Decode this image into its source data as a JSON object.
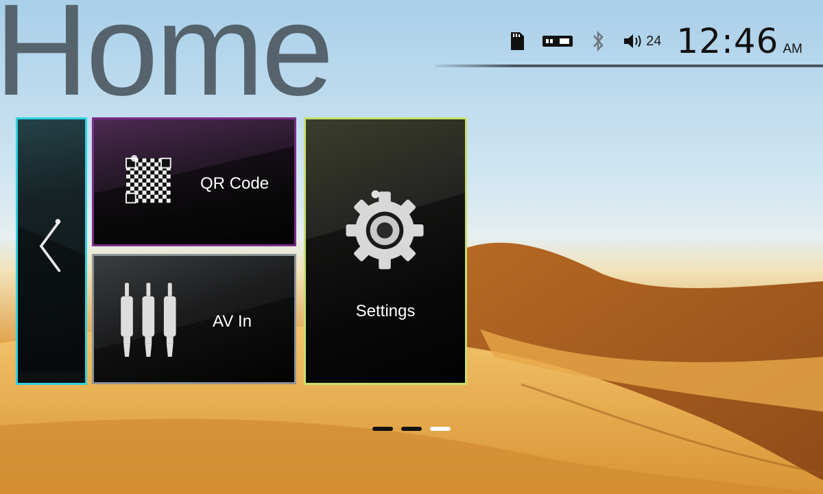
{
  "page": {
    "title": "Home"
  },
  "status_bar": {
    "icons": [
      "sd-card-icon",
      "usb-icon",
      "bluetooth-icon",
      "volume-icon"
    ],
    "volume": "24",
    "time": "12:46",
    "ampm": "AM"
  },
  "tiles": {
    "back": {
      "icon": "chevron-left-icon"
    },
    "qr": {
      "label": "QR Code",
      "icon": "qr-code-icon"
    },
    "av": {
      "label": "AV In",
      "icon": "rca-plugs-icon"
    },
    "settings": {
      "label": "Settings",
      "icon": "gear-icon"
    }
  },
  "pager": {
    "pages": 3,
    "active_index": 2
  },
  "colors": {
    "back_border": "#2fd3e3",
    "qr_border": "#7b2d86",
    "av_border": "#8f9498",
    "settings_border": "#c7e06f"
  }
}
